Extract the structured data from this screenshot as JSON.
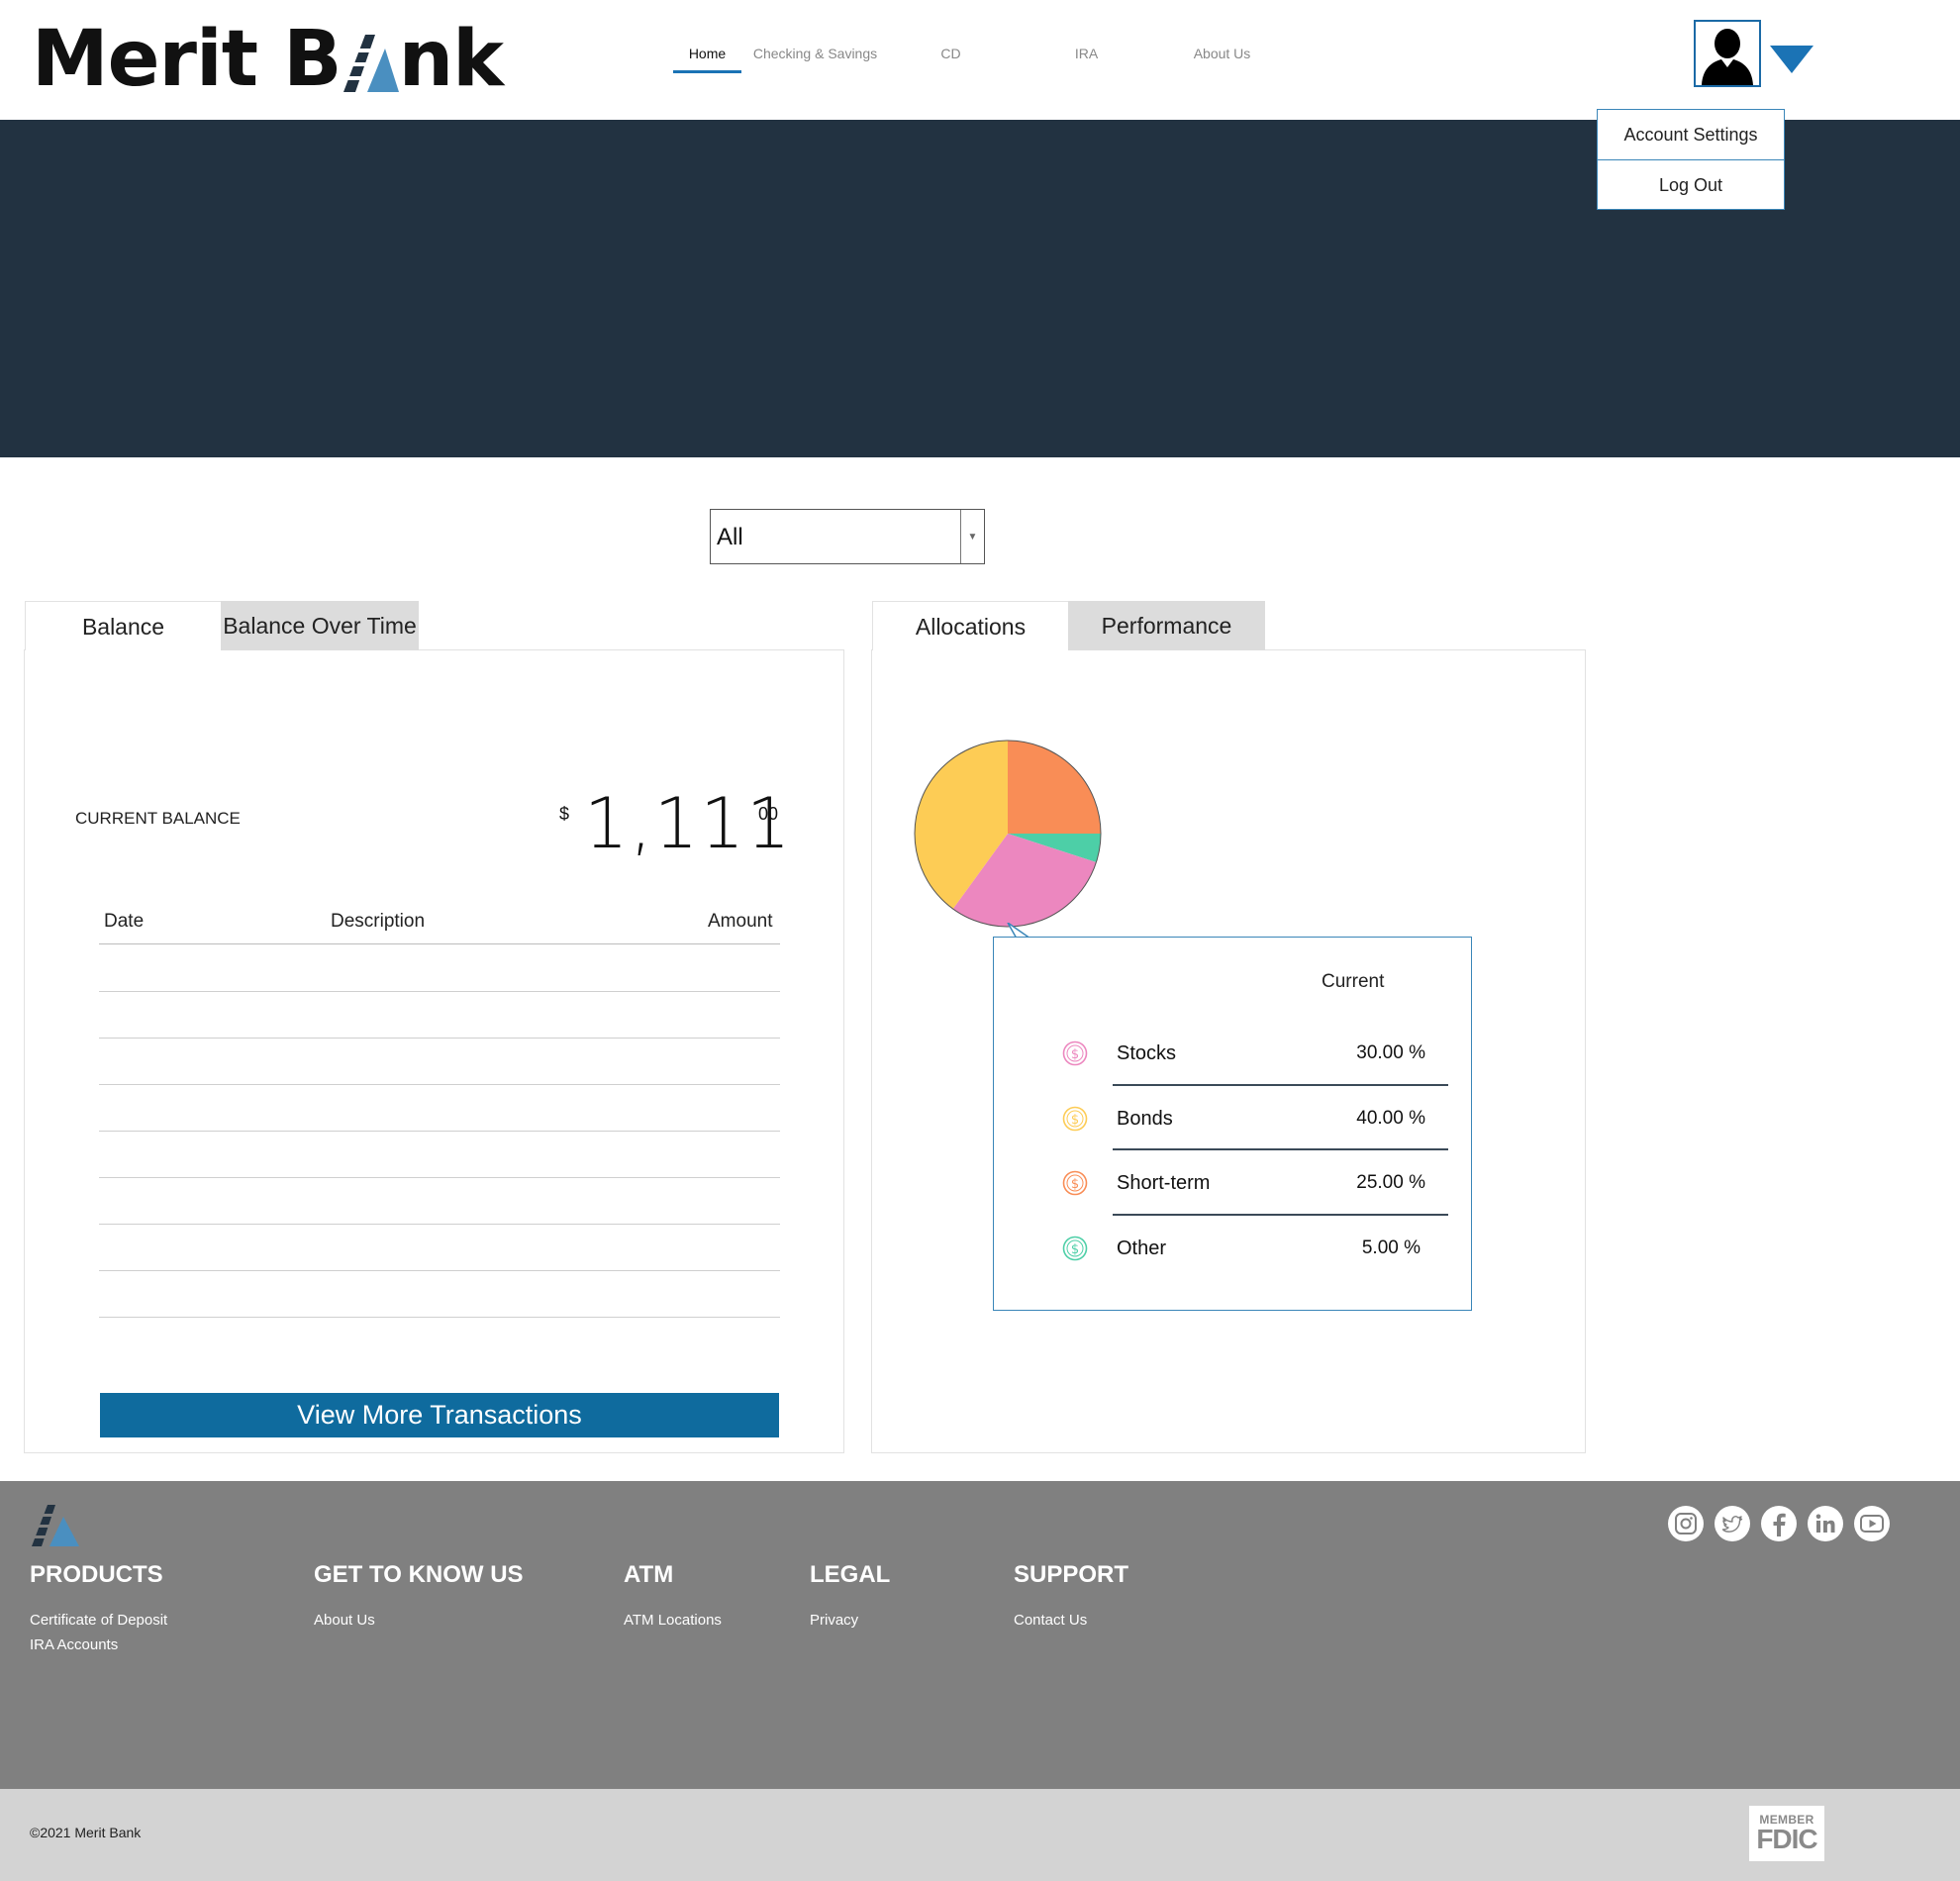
{
  "brand": {
    "name_part1": "Merit B",
    "name_part2": "nk"
  },
  "nav": {
    "items": [
      {
        "label": "Home",
        "active": true
      },
      {
        "label": "Checking & Savings",
        "active": false
      },
      {
        "label": "CD",
        "active": false
      },
      {
        "label": "IRA",
        "active": false
      },
      {
        "label": "About Us",
        "active": false
      }
    ]
  },
  "user_menu": {
    "items": [
      "Account Settings",
      "Log Out"
    ]
  },
  "account_selector": {
    "value": "All"
  },
  "balance_panel": {
    "tabs": [
      "Balance",
      "Balance Over Time"
    ],
    "active_tab": "Balance",
    "current_balance_label": "CURRENT BALANCE",
    "currency_symbol": "$",
    "amount_whole": "1,111",
    "amount_cents": "00",
    "table_headers": {
      "date": "Date",
      "description": "Description",
      "amount": "Amount"
    },
    "empty_rows": 8,
    "view_more_label": "View More Transactions"
  },
  "allocation_panel": {
    "tabs": [
      "Allocations",
      "Performance"
    ],
    "active_tab": "Allocations",
    "column_header": "Current",
    "items": [
      {
        "name": "Stocks",
        "percent": "30.00 %",
        "value": 30,
        "color": "#ec87bf"
      },
      {
        "name": "Bonds",
        "percent": "40.00 %",
        "value": 40,
        "color": "#fdcc55"
      },
      {
        "name": "Short-term",
        "percent": "25.00 %",
        "value": 25,
        "color": "#f98d56"
      },
      {
        "name": "Other",
        "percent": "5.00 %",
        "value": 5,
        "color": "#4dcfa7"
      }
    ]
  },
  "footer": {
    "columns": [
      {
        "heading": "PRODUCTS",
        "links": [
          "Certificate of Deposit",
          "IRA Accounts"
        ]
      },
      {
        "heading": "GET TO KNOW US",
        "links": [
          "About Us"
        ]
      },
      {
        "heading": "ATM",
        "links": [
          "ATM Locations"
        ]
      },
      {
        "heading": "LEGAL",
        "links": [
          "Privacy"
        ]
      },
      {
        "heading": "SUPPORT",
        "links": [
          "Contact Us"
        ]
      }
    ],
    "social": [
      "instagram-icon",
      "twitter-icon",
      "facebook-icon",
      "linkedin-icon",
      "youtube-icon"
    ],
    "copyright": "©2021 Merit Bank",
    "fdic": {
      "top": "MEMBER",
      "bottom": "FDIC"
    }
  },
  "colors": {
    "hero": "#223241",
    "accent": "#0f6b9e",
    "footer": "#808080",
    "bottom_bar": "#d3d3d3"
  }
}
